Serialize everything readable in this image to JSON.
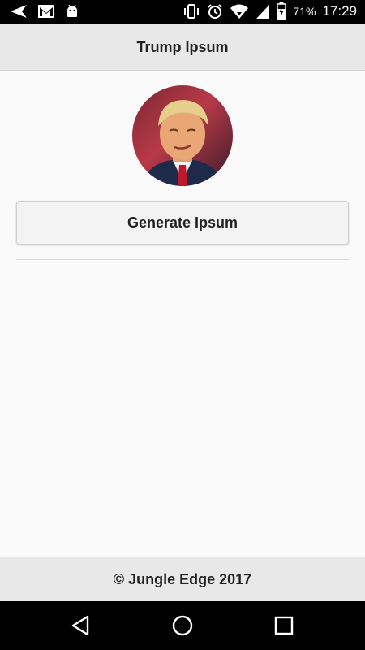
{
  "status_bar": {
    "icons_left": [
      "send-icon",
      "gmail-icon",
      "android-icon"
    ],
    "icons_right": [
      "vibrate-icon",
      "alarm-icon",
      "wifi-icon",
      "signal-icon",
      "battery-icon"
    ],
    "battery_percent": "71%",
    "time": "17:29"
  },
  "header": {
    "title": "Trump Ipsum"
  },
  "main": {
    "avatar_icon": "avatar-photo",
    "generate_button_label": "Generate Ipsum"
  },
  "footer": {
    "text": "© Jungle Edge 2017"
  },
  "nav_bar": {
    "buttons": [
      "back-icon",
      "home-icon",
      "recents-icon"
    ]
  },
  "colors": {
    "status_bar_bg": "#000000",
    "header_bg": "#e8e8e8",
    "page_bg": "#fafafa",
    "button_bg": "#f3f3f3",
    "text": "#222222"
  }
}
